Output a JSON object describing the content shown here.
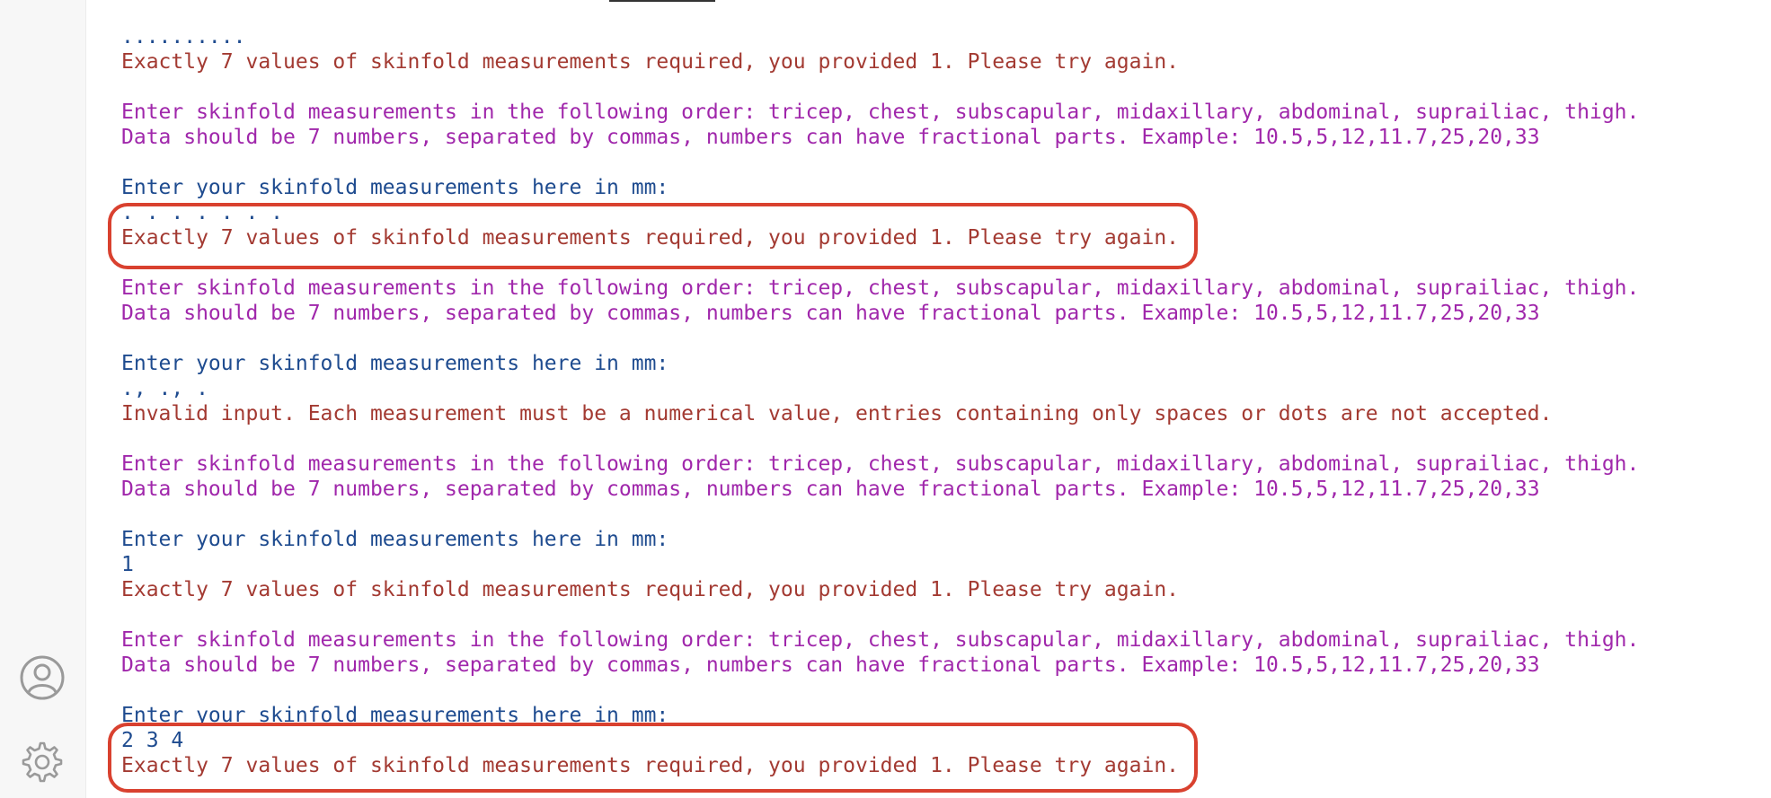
{
  "sidebar": {
    "icons": [
      "user-icon",
      "gear-icon"
    ]
  },
  "colors": {
    "prompt_blue": "#1e4b8f",
    "error_red": "#a33a32",
    "instruction_purple": "#a027ab",
    "highlight_red": "#d9412f"
  },
  "console": {
    "lines": [
      {
        "text": "..........",
        "kind": "input"
      },
      {
        "text": "Exactly 7 values of skinfold measurements required, you provided 1. Please try again.",
        "kind": "error"
      },
      {
        "text": "",
        "kind": "blank"
      },
      {
        "text": "Enter skinfold measurements in the following order: tricep, chest, subscapular, midaxillary, abdominal, suprailiac, thigh.",
        "kind": "instruction"
      },
      {
        "text": "Data should be 7 numbers, separated by commas, numbers can have fractional parts. Example: 10.5,5,12,11.7,25,20,33",
        "kind": "instruction"
      },
      {
        "text": "",
        "kind": "blank"
      },
      {
        "text": "Enter your skinfold measurements here in mm:",
        "kind": "prompt"
      },
      {
        "text": ". . . . . . .",
        "kind": "input"
      },
      {
        "text": "Exactly 7 values of skinfold measurements required, you provided 1. Please try again.",
        "kind": "error"
      },
      {
        "text": "",
        "kind": "blank"
      },
      {
        "text": "Enter skinfold measurements in the following order: tricep, chest, subscapular, midaxillary, abdominal, suprailiac, thigh.",
        "kind": "instruction"
      },
      {
        "text": "Data should be 7 numbers, separated by commas, numbers can have fractional parts. Example: 10.5,5,12,11.7,25,20,33",
        "kind": "instruction"
      },
      {
        "text": "",
        "kind": "blank"
      },
      {
        "text": "Enter your skinfold measurements here in mm:",
        "kind": "prompt"
      },
      {
        "text": "., ., .",
        "kind": "input"
      },
      {
        "text": "Invalid input. Each measurement must be a numerical value, entries containing only spaces or dots are not accepted.",
        "kind": "error"
      },
      {
        "text": "",
        "kind": "blank"
      },
      {
        "text": "Enter skinfold measurements in the following order: tricep, chest, subscapular, midaxillary, abdominal, suprailiac, thigh.",
        "kind": "instruction"
      },
      {
        "text": "Data should be 7 numbers, separated by commas, numbers can have fractional parts. Example: 10.5,5,12,11.7,25,20,33",
        "kind": "instruction"
      },
      {
        "text": "",
        "kind": "blank"
      },
      {
        "text": "Enter your skinfold measurements here in mm:",
        "kind": "prompt"
      },
      {
        "text": "1",
        "kind": "input"
      },
      {
        "text": "Exactly 7 values of skinfold measurements required, you provided 1. Please try again.",
        "kind": "error"
      },
      {
        "text": "",
        "kind": "blank"
      },
      {
        "text": "Enter skinfold measurements in the following order: tricep, chest, subscapular, midaxillary, abdominal, suprailiac, thigh.",
        "kind": "instruction"
      },
      {
        "text": "Data should be 7 numbers, separated by commas, numbers can have fractional parts. Example: 10.5,5,12,11.7,25,20,33",
        "kind": "instruction"
      },
      {
        "text": "",
        "kind": "blank"
      },
      {
        "text": "Enter your skinfold measurements here in mm:",
        "kind": "prompt"
      },
      {
        "text": "2 3 4",
        "kind": "input"
      },
      {
        "text": "Exactly 7 values of skinfold measurements required, you provided 1. Please try again.",
        "kind": "error"
      }
    ]
  }
}
